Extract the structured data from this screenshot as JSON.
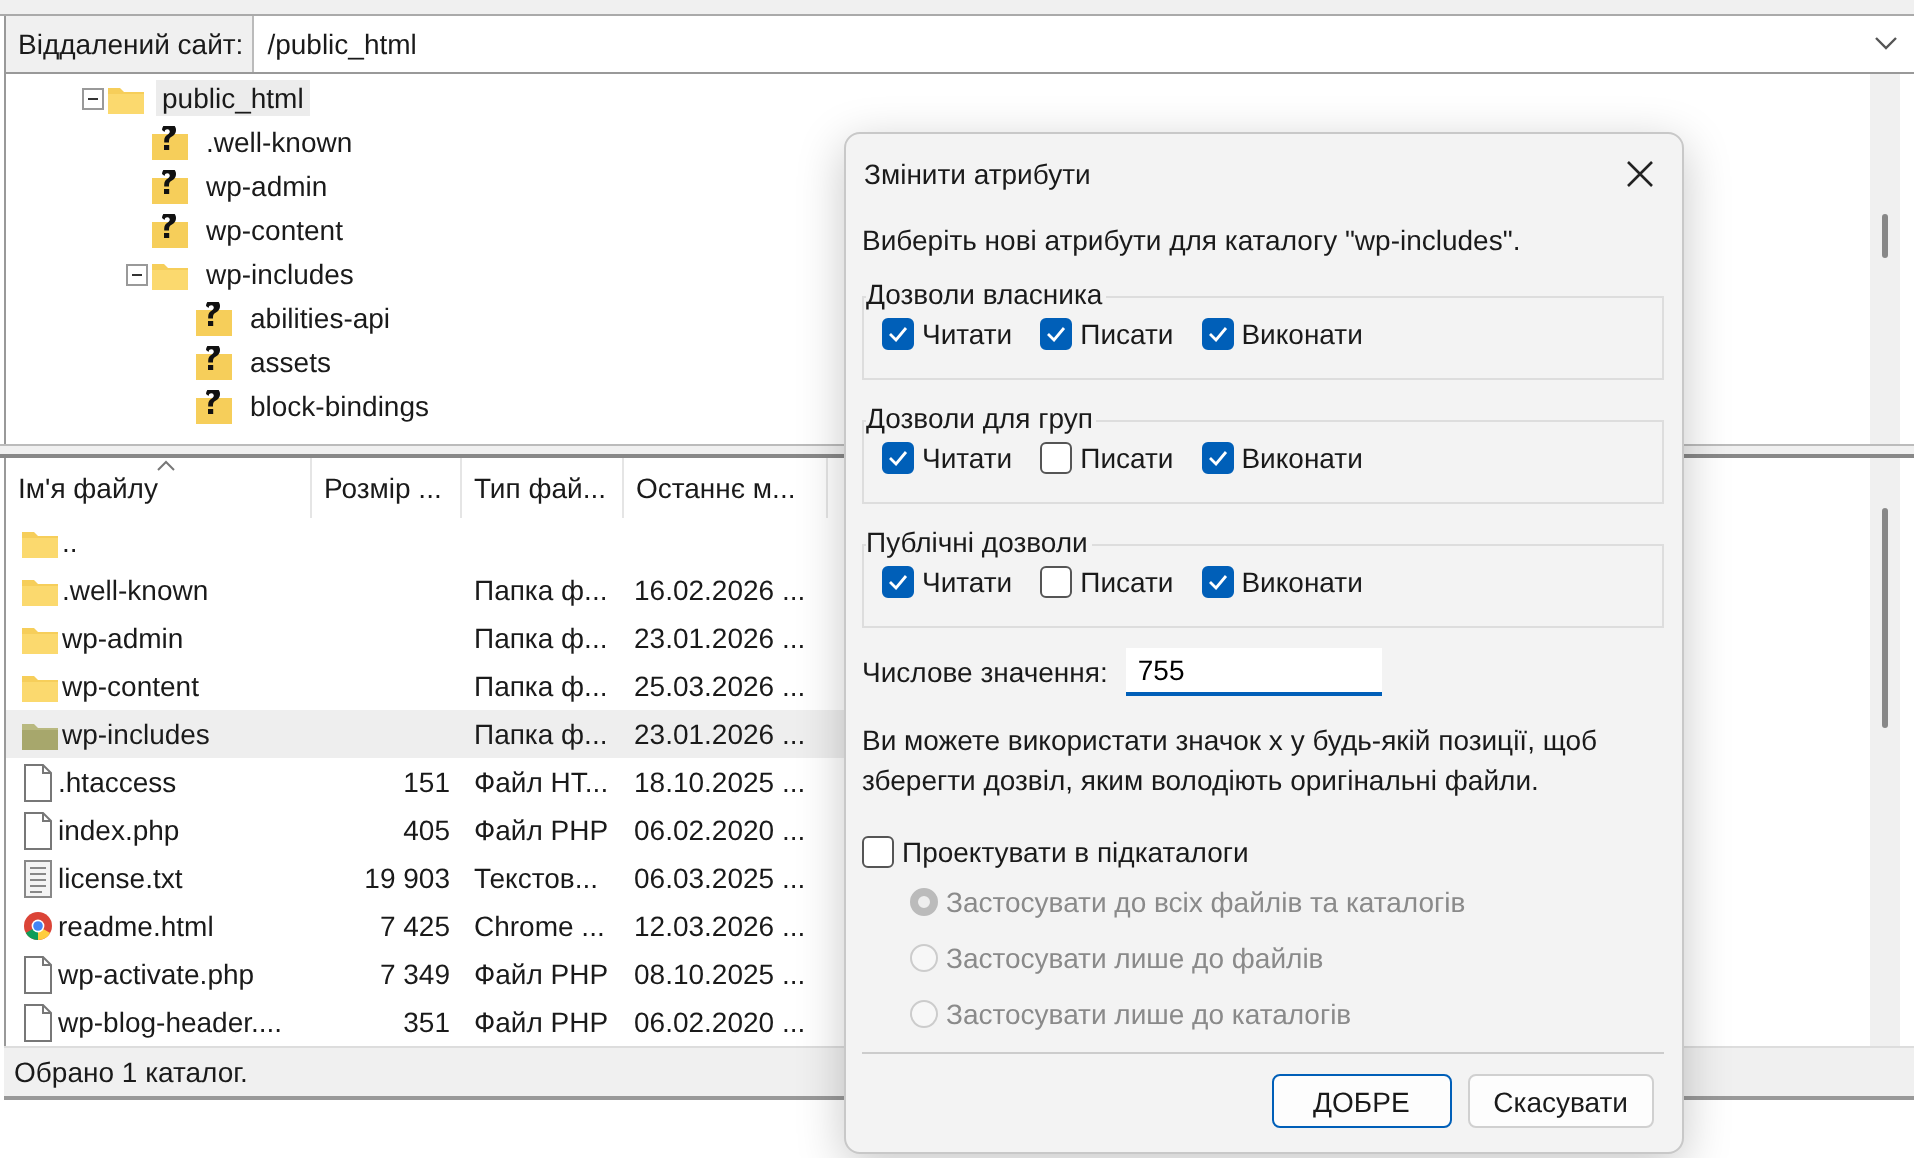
{
  "site": {
    "label": "Віддалений сайт:",
    "path": "/public_html"
  },
  "tree": [
    {
      "name": "public_html",
      "kind": "folder",
      "expanded": true,
      "selected": true,
      "children": [
        {
          "name": ".well-known",
          "kind": "unknown",
          "selected": false
        },
        {
          "name": "wp-admin",
          "kind": "unknown",
          "selected": false
        },
        {
          "name": "wp-content",
          "kind": "unknown",
          "selected": false
        },
        {
          "name": "wp-includes",
          "kind": "folder",
          "expanded": true,
          "selected": false,
          "children": [
            {
              "name": "abilities-api",
              "kind": "unknown",
              "selected": false
            },
            {
              "name": "assets",
              "kind": "unknown",
              "selected": false
            },
            {
              "name": "block-bindings",
              "kind": "unknown",
              "selected": false
            }
          ]
        }
      ]
    }
  ],
  "files": {
    "columns": [
      "Ім'я файлу",
      "Розмір ...",
      "Тип фай...",
      "Останнє м..."
    ],
    "rows": [
      {
        "kind": "folder",
        "name": "..",
        "size": "",
        "type": "",
        "modified": "",
        "selected": false
      },
      {
        "kind": "folder",
        "name": ".well-known",
        "size": "",
        "type": "Папка ф...",
        "modified": "16.02.2026 ...",
        "selected": false
      },
      {
        "kind": "folder",
        "name": "wp-admin",
        "size": "",
        "type": "Папка ф...",
        "modified": "23.01.2026 ...",
        "selected": false
      },
      {
        "kind": "folder",
        "name": "wp-content",
        "size": "",
        "type": "Папка ф...",
        "modified": "25.03.2026 ...",
        "selected": false
      },
      {
        "kind": "folder",
        "name": "wp-includes",
        "size": "",
        "type": "Папка ф...",
        "modified": "23.01.2026 ...",
        "selected": true
      },
      {
        "kind": "file",
        "name": ".htaccess",
        "size": "151",
        "type": "Файл HT...",
        "modified": "18.10.2025 ...",
        "selected": false
      },
      {
        "kind": "file",
        "name": "index.php",
        "size": "405",
        "type": "Файл PHP",
        "modified": "06.02.2020 ...",
        "selected": false
      },
      {
        "kind": "text",
        "name": "license.txt",
        "size": "19 903",
        "type": "Текстов...",
        "modified": "06.03.2025 ...",
        "selected": false
      },
      {
        "kind": "browser",
        "name": "readme.html",
        "size": "7 425",
        "type": "Chrome ...",
        "modified": "12.03.2026 ...",
        "selected": false
      },
      {
        "kind": "file",
        "name": "wp-activate.php",
        "size": "7 349",
        "type": "Файл PHP",
        "modified": "08.10.2025 ...",
        "selected": false
      },
      {
        "kind": "file",
        "name": "wp-blog-header....",
        "size": "351",
        "type": "Файл PHP",
        "modified": "06.02.2020 ...",
        "selected": false
      }
    ]
  },
  "status_bar": "Обрано 1 каталог.",
  "dialog": {
    "title": "Змінити атрибути",
    "prompt": "Виберіть нові атрибути для каталогу \"wp-includes\".",
    "groups": [
      {
        "title": "Дозволи власника",
        "perms": [
          {
            "label": "Читати",
            "checked": true
          },
          {
            "label": "Писати",
            "checked": true
          },
          {
            "label": "Виконати",
            "checked": true
          }
        ]
      },
      {
        "title": "Дозволи для груп",
        "perms": [
          {
            "label": "Читати",
            "checked": true
          },
          {
            "label": "Писати",
            "checked": false
          },
          {
            "label": "Виконати",
            "checked": true
          }
        ]
      },
      {
        "title": "Публічні дозволи",
        "perms": [
          {
            "label": "Читати",
            "checked": true
          },
          {
            "label": "Писати",
            "checked": false
          },
          {
            "label": "Виконати",
            "checked": true
          }
        ]
      }
    ],
    "numeric": {
      "label": "Числове значення:",
      "value": "755"
    },
    "note": "Ви можете використати значок x у будь-якій позиції, щоб зберегти дозвіл, яким володіють оригінальні файли.",
    "recurse": {
      "label": "Проектувати в підкаталоги",
      "checked": false
    },
    "options": [
      {
        "label": "Застосувати до всіх файлів та каталогів",
        "selected": true,
        "disabled": true
      },
      {
        "label": "Застосувати лише до файлів",
        "selected": false,
        "disabled": true
      },
      {
        "label": "Застосувати лише до каталогів",
        "selected": false,
        "disabled": true
      }
    ],
    "buttons": [
      {
        "label": "ДОБРЕ",
        "default": true
      },
      {
        "label": "Скасувати",
        "default": false
      }
    ]
  }
}
